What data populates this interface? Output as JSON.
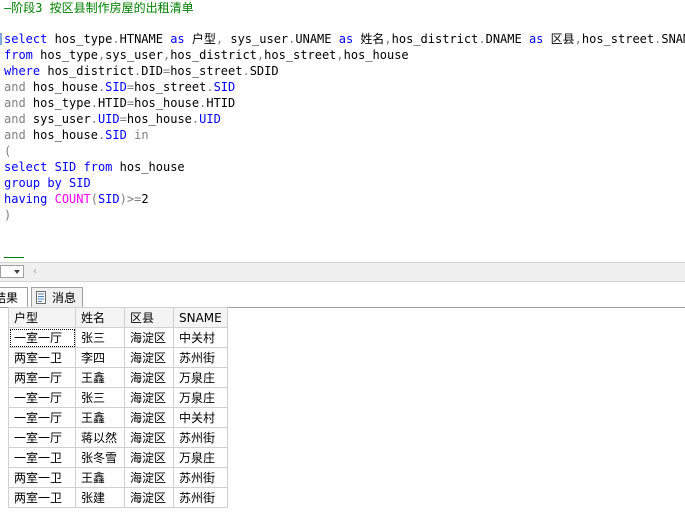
{
  "editor": {
    "comment": "—阶段3 按区县制作房屋的出租清单",
    "lines": [
      [
        {
          "t": "kw",
          "v": "select"
        },
        {
          "t": "id",
          "v": " hos_type"
        },
        {
          "t": "op",
          "v": "."
        },
        {
          "t": "id",
          "v": "HTNAME "
        },
        {
          "t": "kw",
          "v": "as"
        },
        {
          "t": "id",
          "v": " 户型"
        },
        {
          "t": "op",
          "v": ", "
        },
        {
          "t": "id",
          "v": "sys_user"
        },
        {
          "t": "op",
          "v": "."
        },
        {
          "t": "id",
          "v": "UNAME "
        },
        {
          "t": "kw",
          "v": "as"
        },
        {
          "t": "id",
          "v": " 姓名"
        },
        {
          "t": "op",
          "v": ","
        },
        {
          "t": "id",
          "v": "hos_district"
        },
        {
          "t": "op",
          "v": "."
        },
        {
          "t": "id",
          "v": "DNAME "
        },
        {
          "t": "kw",
          "v": "as"
        },
        {
          "t": "id",
          "v": " 区县"
        },
        {
          "t": "op",
          "v": ","
        },
        {
          "t": "id",
          "v": "hos_street"
        },
        {
          "t": "op",
          "v": "."
        },
        {
          "t": "id",
          "v": "SNAME"
        }
      ],
      [
        {
          "t": "kw",
          "v": "from"
        },
        {
          "t": "id",
          "v": " hos_type"
        },
        {
          "t": "op",
          "v": ","
        },
        {
          "t": "id",
          "v": "sys_user"
        },
        {
          "t": "op",
          "v": ","
        },
        {
          "t": "id",
          "v": "hos_district"
        },
        {
          "t": "op",
          "v": ","
        },
        {
          "t": "id",
          "v": "hos_street"
        },
        {
          "t": "op",
          "v": ","
        },
        {
          "t": "id",
          "v": "hos_house"
        }
      ],
      [
        {
          "t": "kw",
          "v": "where"
        },
        {
          "t": "id",
          "v": " hos_district"
        },
        {
          "t": "op",
          "v": "."
        },
        {
          "t": "id",
          "v": "DID"
        },
        {
          "t": "op",
          "v": "="
        },
        {
          "t": "id",
          "v": "hos_street"
        },
        {
          "t": "op",
          "v": "."
        },
        {
          "t": "id",
          "v": "SDID"
        }
      ],
      [
        {
          "t": "op",
          "v": "and"
        },
        {
          "t": "id",
          "v": " hos_house"
        },
        {
          "t": "op",
          "v": "."
        },
        {
          "t": "kw",
          "v": "SID"
        },
        {
          "t": "op",
          "v": "="
        },
        {
          "t": "id",
          "v": "hos_street"
        },
        {
          "t": "op",
          "v": "."
        },
        {
          "t": "kw",
          "v": "SID"
        }
      ],
      [
        {
          "t": "op",
          "v": "and"
        },
        {
          "t": "id",
          "v": " hos_type"
        },
        {
          "t": "op",
          "v": "."
        },
        {
          "t": "id",
          "v": "HTID"
        },
        {
          "t": "op",
          "v": "="
        },
        {
          "t": "id",
          "v": "hos_house"
        },
        {
          "t": "op",
          "v": "."
        },
        {
          "t": "id",
          "v": "HTID"
        }
      ],
      [
        {
          "t": "op",
          "v": "and"
        },
        {
          "t": "id",
          "v": " sys_user"
        },
        {
          "t": "op",
          "v": "."
        },
        {
          "t": "kw",
          "v": "UID"
        },
        {
          "t": "op",
          "v": "="
        },
        {
          "t": "id",
          "v": "hos_house"
        },
        {
          "t": "op",
          "v": "."
        },
        {
          "t": "kw",
          "v": "UID"
        }
      ],
      [
        {
          "t": "op",
          "v": "and"
        },
        {
          "t": "id",
          "v": " hos_house"
        },
        {
          "t": "op",
          "v": "."
        },
        {
          "t": "kw",
          "v": "SID"
        },
        {
          "t": "id",
          "v": " "
        },
        {
          "t": "op",
          "v": "in"
        }
      ],
      [
        {
          "t": "op",
          "v": "("
        }
      ],
      [
        {
          "t": "kw",
          "v": "select"
        },
        {
          "t": "kw",
          "v": " SID"
        },
        {
          "t": "id",
          "v": " "
        },
        {
          "t": "kw",
          "v": "from"
        },
        {
          "t": "id",
          "v": " hos_house"
        }
      ],
      [
        {
          "t": "kw",
          "v": "group by"
        },
        {
          "t": "kw",
          "v": " SID"
        }
      ],
      [
        {
          "t": "kw",
          "v": "having"
        },
        {
          "t": "id",
          "v": " "
        },
        {
          "t": "fn",
          "v": "COUNT"
        },
        {
          "t": "op",
          "v": "("
        },
        {
          "t": "kw",
          "v": "SID"
        },
        {
          "t": "op",
          "v": ")>="
        },
        {
          "t": "id",
          "v": "2"
        }
      ],
      [
        {
          "t": "op",
          "v": ")"
        }
      ]
    ]
  },
  "tabs": {
    "results_label": "结果",
    "messages_label": "消息"
  },
  "grid": {
    "headers": [
      "户型",
      "姓名",
      "区县",
      "SNAME"
    ],
    "rows": [
      [
        "一室一厅",
        "张三",
        "海淀区",
        "中关村"
      ],
      [
        "两室一卫",
        "李四",
        "海淀区",
        "苏州街"
      ],
      [
        "两室一厅",
        "王鑫",
        "海淀区",
        "万泉庄"
      ],
      [
        "一室一厅",
        "张三",
        "海淀区",
        "万泉庄"
      ],
      [
        "一室一厅",
        "王鑫",
        "海淀区",
        "中关村"
      ],
      [
        "一室一厅",
        "蒋以然",
        "海淀区",
        "苏州街"
      ],
      [
        "一室一卫",
        "张冬雪",
        "海淀区",
        "万泉庄"
      ],
      [
        "两室一卫",
        "王鑫",
        "海淀区",
        "苏州街"
      ],
      [
        "两室一卫",
        "张建",
        "海淀区",
        "苏州街"
      ]
    ]
  },
  "colors": {
    "keyword": "#0000ff",
    "comment": "#008000",
    "function": "#ff00ff",
    "operator": "#808080"
  },
  "icons": {
    "messages_tab": "message-page-icon",
    "zoom_dropdown": "chevron-down-icon",
    "scroll_left": "chevron-left-icon"
  }
}
